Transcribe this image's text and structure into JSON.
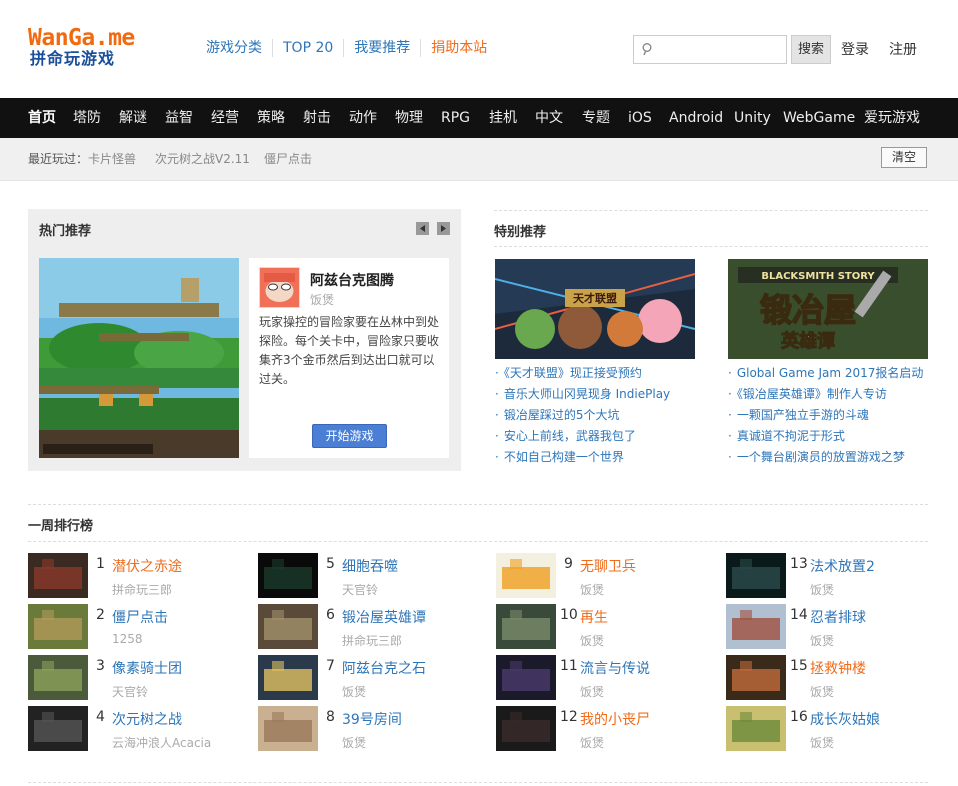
{
  "header": {
    "logo_top": "WanGa.me",
    "logo_bottom": "拼命玩游戏",
    "nav": [
      "游戏分类",
      "TOP 20",
      "我要推荐",
      "捐助本站"
    ],
    "search_placeholder": "",
    "search_button": "搜索",
    "login": "登录",
    "register": "注册"
  },
  "categories": [
    "首页",
    "塔防",
    "解谜",
    "益智",
    "经营",
    "策略",
    "射击",
    "动作",
    "物理",
    "RPG",
    "挂机",
    "中文",
    "专题",
    "iOS",
    "Android",
    "Unity",
    "WebGame",
    "爱玩游戏"
  ],
  "recent": {
    "label": "最近玩过：",
    "games": [
      "卡片怪兽",
      "次元树之战V2.11",
      "僵尸点击"
    ],
    "clear": "清空"
  },
  "hot": {
    "title": "热门推荐",
    "game_name": "阿兹台克图腾",
    "author": "饭煲",
    "description": "玩家操控的冒险家要在丛林中到处探险。每个关卡中，冒险家只要收集齐3个金币然后到达出口就可以过关。",
    "play_button": "开始游戏"
  },
  "special": {
    "title": "特别推荐",
    "left_image_text": "天才联盟",
    "right_image_text": "锻冶屋",
    "right_image_sub": "英雄谭",
    "right_image_banner": "BLACKSMITH STORY",
    "left_list": [
      "《天才联盟》现正接受预约",
      "音乐大师山冈晃现身 IndiePlay",
      "锻冶屋踩过的5个大坑",
      "安心上前线，武器我包了",
      "不如自己构建一个世界"
    ],
    "right_list": [
      "Global Game Jam 2017报名启动",
      "《锻冶屋英雄谭》制作人专访",
      "一颗国产独立手游的斗魂",
      "真诚道不拘泥于形式",
      "一个舞台剧演员的放置游戏之梦"
    ]
  },
  "ranking": {
    "title": "一周排行榜",
    "items": [
      {
        "num": "1",
        "name": "潜伏之赤途",
        "author": "拼命玩三郎",
        "hot": true
      },
      {
        "num": "2",
        "name": "僵尸点击",
        "author": "1258",
        "hot": false
      },
      {
        "num": "3",
        "name": "像素骑士团",
        "author": "天官铃",
        "hot": false
      },
      {
        "num": "4",
        "name": "次元树之战",
        "author": "云海冲浪人Acacia",
        "hot": false
      },
      {
        "num": "5",
        "name": "细胞吞噬",
        "author": "天官铃",
        "hot": false
      },
      {
        "num": "6",
        "name": "锻冶屋英雄谭",
        "author": "拼命玩三郎",
        "hot": false
      },
      {
        "num": "7",
        "name": "阿兹台克之石",
        "author": "饭煲",
        "hot": false
      },
      {
        "num": "8",
        "name": "39号房间",
        "author": "饭煲",
        "hot": false
      },
      {
        "num": "9",
        "name": "无聊卫兵",
        "author": "饭煲",
        "hot": true
      },
      {
        "num": "10",
        "name": "再生",
        "author": "饭煲",
        "hot": true
      },
      {
        "num": "11",
        "name": "流言与传说",
        "author": "饭煲",
        "hot": false
      },
      {
        "num": "12",
        "name": "我的小丧尸",
        "author": "饭煲",
        "hot": true
      },
      {
        "num": "13",
        "name": "法术放置2",
        "author": "饭煲",
        "hot": false
      },
      {
        "num": "14",
        "name": "忍者排球",
        "author": "饭煲",
        "hot": false
      },
      {
        "num": "15",
        "name": "拯救钟楼",
        "author": "饭煲",
        "hot": true
      },
      {
        "num": "16",
        "name": "成长灰姑娘",
        "author": "饭煲",
        "hot": false
      }
    ]
  },
  "colors": {
    "link_blue": "#2e76b8",
    "accent_orange": "#f06c1c",
    "nav_bar": "#111111",
    "play_button": "#4b7fd6"
  }
}
